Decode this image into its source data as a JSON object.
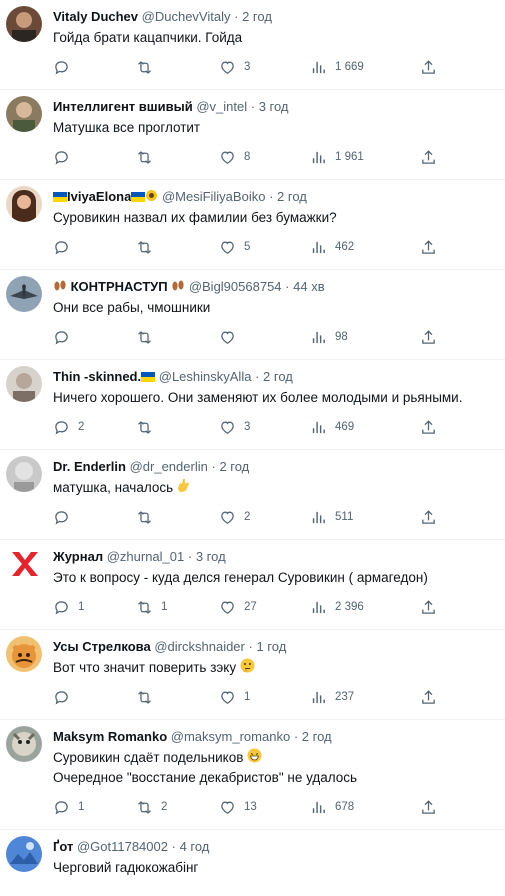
{
  "replies": [
    {
      "name": "Vitaly Duchev",
      "handle": "@DuchevVitaly",
      "time": "2 год",
      "text": [
        "Гойда брати кацапчики. Гойда"
      ],
      "replies": "",
      "retweets": "",
      "likes": "3",
      "views": "1 669"
    },
    {
      "name": "Интеллигент вшивый",
      "handle": "@v_intel",
      "time": "3 год",
      "text": [
        "Матушка все проглотит"
      ],
      "replies": "",
      "retweets": "",
      "likes": "8",
      "views": "1 961"
    },
    {
      "name": "IviyaElona",
      "handle": "@MesiFiliyaBoiko",
      "time": "2 год",
      "text": [
        "Суровикин назвал их фамилии без бумажки?"
      ],
      "replies": "",
      "retweets": "",
      "likes": "5",
      "views": "462"
    },
    {
      "name": "КОНТРНАСТУП",
      "handle": "@Bigl90568754",
      "time": "44 хв",
      "text": [
        "Они все рабы, чмошники"
      ],
      "replies": "",
      "retweets": "",
      "likes": "",
      "views": "98"
    },
    {
      "name": "Thin -skinned.",
      "handle": "@LeshinskyAlla",
      "time": "2 год",
      "text": [
        "Ничего хорошего. Они заменяют их более молодыми и  рьяными."
      ],
      "replies": "2",
      "retweets": "",
      "likes": "3",
      "views": "469"
    },
    {
      "name": "Dr. Enderlin",
      "handle": "@dr_enderlin",
      "time": "2 год",
      "text": [
        "матушка, началось"
      ],
      "replies": "",
      "retweets": "",
      "likes": "2",
      "views": "511"
    },
    {
      "name": "Журнал",
      "handle": "@zhurnal_01",
      "time": "3 год",
      "text": [
        "Это к вопросу - куда делся генерал Суровикин ( армагедон)"
      ],
      "replies": "1",
      "retweets": "1",
      "likes": "27",
      "views": "2 396"
    },
    {
      "name": "Усы Стрелкова",
      "handle": "@dirckshnaider",
      "time": "1 год",
      "text": [
        "Вот что значит поверить зэку"
      ],
      "replies": "",
      "retweets": "",
      "likes": "1",
      "views": "237"
    },
    {
      "name": "Maksym Romanko",
      "handle": "@maksym_romanko",
      "time": "2 год",
      "text": [
        "Суровикин сдаёт подельников",
        "Очередное \"восстание декабристов\" не удалось"
      ],
      "replies": "1",
      "retweets": "2",
      "likes": "13",
      "views": "678"
    },
    {
      "name": "Ґот",
      "handle": "@Got11784002",
      "time": "4 год",
      "text": [
        "Черговий гадюкожабінг"
      ],
      "replies": "",
      "retweets": "",
      "likes": "",
      "views": ""
    }
  ],
  "colors": {
    "text": "#0f1419",
    "muted": "#536471",
    "divider": "#eff3f4"
  },
  "icons": [
    "reply-icon",
    "retweet-icon",
    "like-icon",
    "views-icon",
    "share-icon"
  ]
}
